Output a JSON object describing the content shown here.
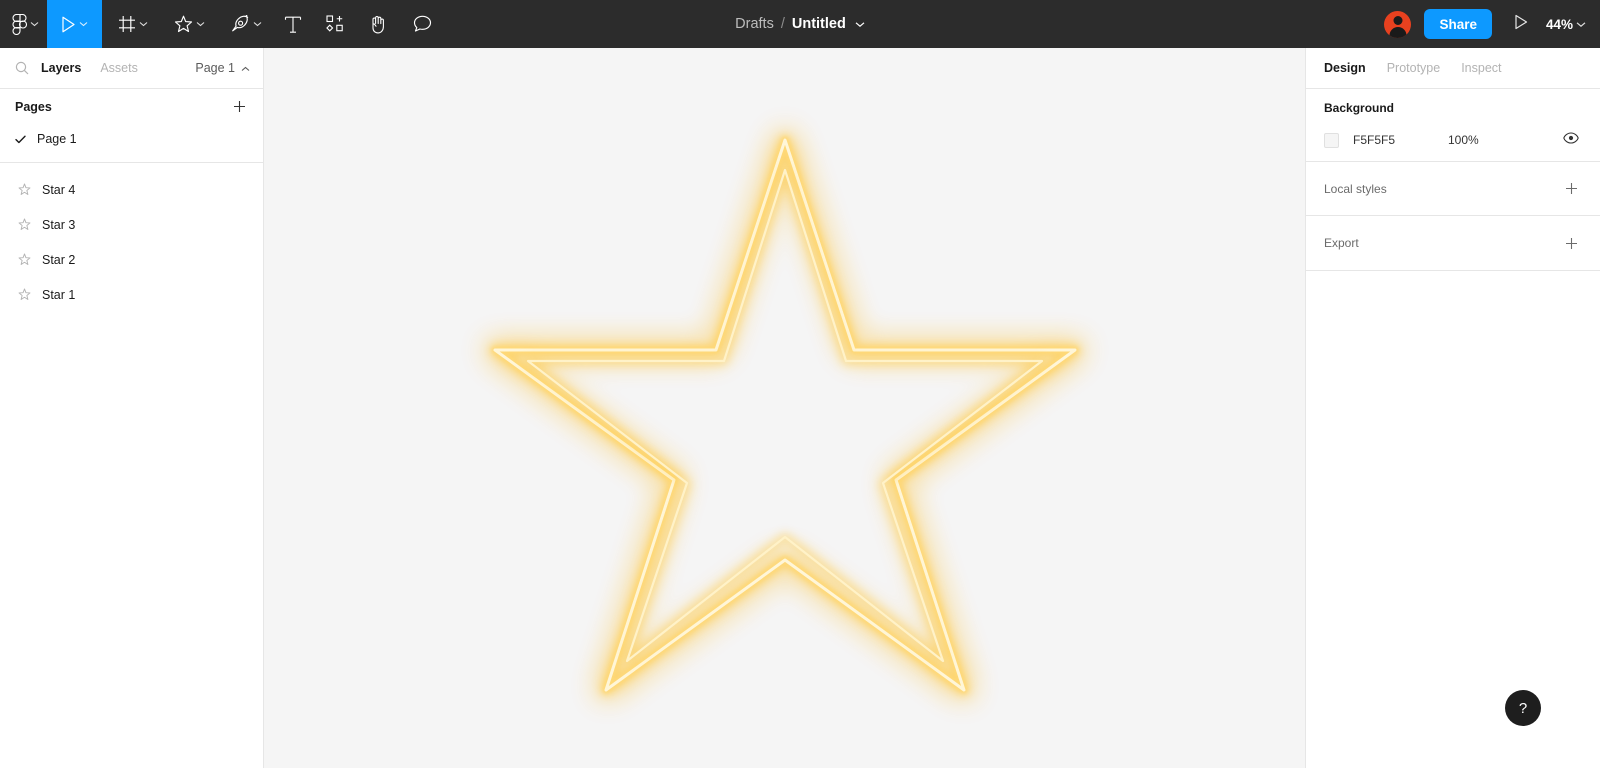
{
  "topbar": {
    "tools": [
      {
        "name": "figma-logo-icon",
        "label": "Figma",
        "chevron": true,
        "active": false
      },
      {
        "name": "move-tool",
        "label": "Move",
        "chevron": true,
        "active": true
      },
      {
        "name": "frame-tool",
        "label": "Frame",
        "chevron": true,
        "active": false
      },
      {
        "name": "shape-tool",
        "label": "Shape",
        "chevron": true,
        "active": false
      },
      {
        "name": "pen-tool",
        "label": "Pen",
        "chevron": true,
        "active": false
      },
      {
        "name": "text-tool",
        "label": "Text",
        "chevron": false,
        "active": false
      },
      {
        "name": "resources-tool",
        "label": "Resources",
        "chevron": false,
        "active": false
      },
      {
        "name": "hand-tool",
        "label": "Hand",
        "chevron": false,
        "active": false
      },
      {
        "name": "comment-tool",
        "label": "Comment",
        "chevron": false,
        "active": false
      }
    ],
    "breadcrumb": {
      "project": "Drafts",
      "separator": "/",
      "file": "Untitled"
    },
    "share_label": "Share",
    "zoom_level": "44%",
    "accent_color": "#0d99ff",
    "bar_color": "#2c2c2c",
    "avatar_color": "#e8411f"
  },
  "left_panel": {
    "tabs": {
      "layers": "Layers",
      "assets": "Assets"
    },
    "page_selector": "Page 1",
    "pages_section": {
      "title": "Pages",
      "add_label": "+"
    },
    "pages": [
      {
        "label": "Page 1",
        "selected": true
      }
    ],
    "layers": [
      {
        "label": "Star 4",
        "icon": "star-icon"
      },
      {
        "label": "Star 3",
        "icon": "star-icon"
      },
      {
        "label": "Star 2",
        "icon": "star-icon"
      },
      {
        "label": "Star 1",
        "icon": "star-icon"
      }
    ]
  },
  "right_panel": {
    "tabs": [
      {
        "label": "Design",
        "active": true
      },
      {
        "label": "Prototype",
        "active": false
      },
      {
        "label": "Inspect",
        "active": false
      }
    ],
    "background": {
      "title": "Background",
      "hex": "F5F5F5",
      "opacity": "100%",
      "swatch_color": "#f5f5f5"
    },
    "local_styles": {
      "title": "Local styles",
      "add_label": "+"
    },
    "export": {
      "title": "Export",
      "add_label": "+"
    }
  },
  "canvas": {
    "background_color": "#f5f5f5",
    "artwork": {
      "name": "neon-star",
      "shape": "5-point-star",
      "stroke_core_color": "#fff6d8",
      "stroke_glow_color": "#ffc940",
      "glow_outer_color": "#ffb300"
    }
  },
  "help": {
    "label": "?"
  }
}
